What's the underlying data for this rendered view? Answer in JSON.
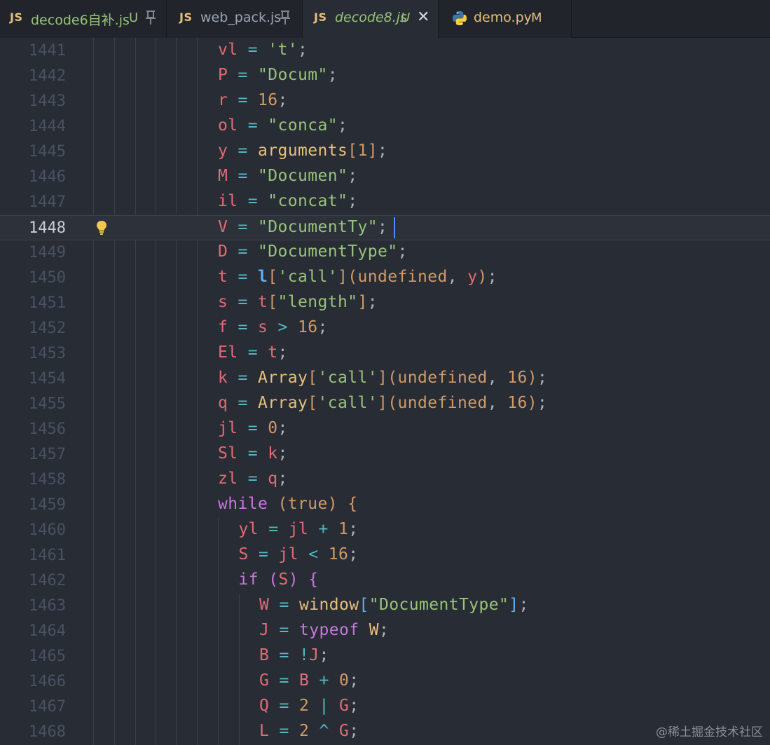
{
  "tabs": [
    {
      "badge": "JS",
      "label": "decode6自补.js",
      "status": "U",
      "pinned": true,
      "active": false,
      "label_color": "#98c379",
      "status_color": "#98c379"
    },
    {
      "badge": "JS",
      "label": "web_pack.js",
      "status": "",
      "pinned": true,
      "active": false,
      "label_color": "#9da5b4",
      "status_color": ""
    },
    {
      "badge": "JS",
      "label": "decode8.js",
      "status": "U",
      "pinned": false,
      "active": true,
      "close_icon": "✕",
      "label_color": "#98c379",
      "status_color": "#98c379"
    },
    {
      "badge": "",
      "icon": "python-icon",
      "label": "demo.py",
      "status": "M",
      "pinned": false,
      "active": false,
      "label_color": "#e5c07b",
      "status_color": "#e5c07b"
    }
  ],
  "editor": {
    "current_line": "1448",
    "lines": [
      {
        "num": "1441",
        "indent": 0,
        "tokens": [
          [
            "var",
            "vl"
          ],
          [
            "pun",
            " "
          ],
          [
            "op",
            "="
          ],
          [
            "pun",
            " "
          ],
          [
            "str",
            "'t'"
          ],
          [
            "pun",
            ";"
          ]
        ]
      },
      {
        "num": "1442",
        "indent": 0,
        "tokens": [
          [
            "var",
            "P"
          ],
          [
            "pun",
            " "
          ],
          [
            "op",
            "="
          ],
          [
            "pun",
            " "
          ],
          [
            "str",
            "\"Docum\""
          ],
          [
            "pun",
            ";"
          ]
        ]
      },
      {
        "num": "1443",
        "indent": 0,
        "tokens": [
          [
            "var",
            "r"
          ],
          [
            "pun",
            " "
          ],
          [
            "op",
            "="
          ],
          [
            "pun",
            " "
          ],
          [
            "num",
            "16"
          ],
          [
            "pun",
            ";"
          ]
        ]
      },
      {
        "num": "1444",
        "indent": 0,
        "tokens": [
          [
            "var",
            "ol"
          ],
          [
            "pun",
            " "
          ],
          [
            "op",
            "="
          ],
          [
            "pun",
            " "
          ],
          [
            "str",
            "\"conca\""
          ],
          [
            "pun",
            ";"
          ]
        ]
      },
      {
        "num": "1445",
        "indent": 0,
        "tokens": [
          [
            "var",
            "y"
          ],
          [
            "pun",
            " "
          ],
          [
            "op",
            "="
          ],
          [
            "pun",
            " "
          ],
          [
            "fn",
            "arguments"
          ],
          [
            "br1",
            "["
          ],
          [
            "num",
            "1"
          ],
          [
            "br1",
            "]"
          ],
          [
            "pun",
            ";"
          ]
        ]
      },
      {
        "num": "1446",
        "indent": 0,
        "tokens": [
          [
            "var",
            "M"
          ],
          [
            "pun",
            " "
          ],
          [
            "op",
            "="
          ],
          [
            "pun",
            " "
          ],
          [
            "str",
            "\"Documen\""
          ],
          [
            "pun",
            ";"
          ]
        ]
      },
      {
        "num": "1447",
        "indent": 0,
        "tokens": [
          [
            "var",
            "il"
          ],
          [
            "pun",
            " "
          ],
          [
            "op",
            "="
          ],
          [
            "pun",
            " "
          ],
          [
            "str",
            "\"concat\""
          ],
          [
            "pun",
            ";"
          ]
        ]
      },
      {
        "num": "1448",
        "indent": 0,
        "tokens": [
          [
            "var",
            "V"
          ],
          [
            "pun",
            " "
          ],
          [
            "op",
            "="
          ],
          [
            "pun",
            " "
          ],
          [
            "str",
            "\"DocumentTy\""
          ],
          [
            "pun",
            ";"
          ]
        ]
      },
      {
        "num": "1449",
        "indent": 0,
        "tokens": [
          [
            "var",
            "D"
          ],
          [
            "pun",
            " "
          ],
          [
            "op",
            "="
          ],
          [
            "pun",
            " "
          ],
          [
            "str",
            "\"DocumentType\""
          ],
          [
            "pun",
            ";"
          ]
        ]
      },
      {
        "num": "1450",
        "indent": 0,
        "tokens": [
          [
            "var",
            "t"
          ],
          [
            "pun",
            " "
          ],
          [
            "op",
            "="
          ],
          [
            "pun",
            " "
          ],
          [
            "call",
            "l"
          ],
          [
            "br1",
            "["
          ],
          [
            "str",
            "'call'"
          ],
          [
            "br1",
            "]"
          ],
          [
            "br1",
            "("
          ],
          [
            "num",
            "undefined"
          ],
          [
            "pun",
            ", "
          ],
          [
            "var",
            "y"
          ],
          [
            "br1",
            ")"
          ],
          [
            "pun",
            ";"
          ]
        ]
      },
      {
        "num": "1451",
        "indent": 0,
        "tokens": [
          [
            "var",
            "s"
          ],
          [
            "pun",
            " "
          ],
          [
            "op",
            "="
          ],
          [
            "pun",
            " "
          ],
          [
            "var",
            "t"
          ],
          [
            "br1",
            "["
          ],
          [
            "str",
            "\"length\""
          ],
          [
            "br1",
            "]"
          ],
          [
            "pun",
            ";"
          ]
        ]
      },
      {
        "num": "1452",
        "indent": 0,
        "tokens": [
          [
            "var",
            "f"
          ],
          [
            "pun",
            " "
          ],
          [
            "op",
            "="
          ],
          [
            "pun",
            " "
          ],
          [
            "var",
            "s"
          ],
          [
            "pun",
            " "
          ],
          [
            "op",
            ">"
          ],
          [
            "pun",
            " "
          ],
          [
            "num",
            "16"
          ],
          [
            "pun",
            ";"
          ]
        ]
      },
      {
        "num": "1453",
        "indent": 0,
        "tokens": [
          [
            "var",
            "El"
          ],
          [
            "pun",
            " "
          ],
          [
            "op",
            "="
          ],
          [
            "pun",
            " "
          ],
          [
            "var",
            "t"
          ],
          [
            "pun",
            ";"
          ]
        ]
      },
      {
        "num": "1454",
        "indent": 0,
        "tokens": [
          [
            "var",
            "k"
          ],
          [
            "pun",
            " "
          ],
          [
            "op",
            "="
          ],
          [
            "pun",
            " "
          ],
          [
            "fn",
            "Array"
          ],
          [
            "br1",
            "["
          ],
          [
            "str",
            "'call'"
          ],
          [
            "br1",
            "]"
          ],
          [
            "br1",
            "("
          ],
          [
            "num",
            "undefined"
          ],
          [
            "pun",
            ", "
          ],
          [
            "num",
            "16"
          ],
          [
            "br1",
            ")"
          ],
          [
            "pun",
            ";"
          ]
        ]
      },
      {
        "num": "1455",
        "indent": 0,
        "tokens": [
          [
            "var",
            "q"
          ],
          [
            "pun",
            " "
          ],
          [
            "op",
            "="
          ],
          [
            "pun",
            " "
          ],
          [
            "fn",
            "Array"
          ],
          [
            "br1",
            "["
          ],
          [
            "str",
            "'call'"
          ],
          [
            "br1",
            "]"
          ],
          [
            "br1",
            "("
          ],
          [
            "num",
            "undefined"
          ],
          [
            "pun",
            ", "
          ],
          [
            "num",
            "16"
          ],
          [
            "br1",
            ")"
          ],
          [
            "pun",
            ";"
          ]
        ]
      },
      {
        "num": "1456",
        "indent": 0,
        "tokens": [
          [
            "var",
            "jl"
          ],
          [
            "pun",
            " "
          ],
          [
            "op",
            "="
          ],
          [
            "pun",
            " "
          ],
          [
            "num",
            "0"
          ],
          [
            "pun",
            ";"
          ]
        ]
      },
      {
        "num": "1457",
        "indent": 0,
        "tokens": [
          [
            "var",
            "Sl"
          ],
          [
            "pun",
            " "
          ],
          [
            "op",
            "="
          ],
          [
            "pun",
            " "
          ],
          [
            "var",
            "k"
          ],
          [
            "pun",
            ";"
          ]
        ]
      },
      {
        "num": "1458",
        "indent": 0,
        "tokens": [
          [
            "var",
            "zl"
          ],
          [
            "pun",
            " "
          ],
          [
            "op",
            "="
          ],
          [
            "pun",
            " "
          ],
          [
            "var",
            "q"
          ],
          [
            "pun",
            ";"
          ]
        ]
      },
      {
        "num": "1459",
        "indent": 0,
        "tokens": [
          [
            "kw",
            "while"
          ],
          [
            "pun",
            " "
          ],
          [
            "br1",
            "("
          ],
          [
            "num",
            "true"
          ],
          [
            "br1",
            ")"
          ],
          [
            "pun",
            " "
          ],
          [
            "br1",
            "{"
          ]
        ]
      },
      {
        "num": "1460",
        "indent": 1,
        "tokens": [
          [
            "var",
            "yl"
          ],
          [
            "pun",
            " "
          ],
          [
            "op",
            "="
          ],
          [
            "pun",
            " "
          ],
          [
            "var",
            "jl"
          ],
          [
            "pun",
            " "
          ],
          [
            "op",
            "+"
          ],
          [
            "pun",
            " "
          ],
          [
            "num",
            "1"
          ],
          [
            "pun",
            ";"
          ]
        ]
      },
      {
        "num": "1461",
        "indent": 1,
        "tokens": [
          [
            "var",
            "S"
          ],
          [
            "pun",
            " "
          ],
          [
            "op",
            "="
          ],
          [
            "pun",
            " "
          ],
          [
            "var",
            "jl"
          ],
          [
            "pun",
            " "
          ],
          [
            "op",
            "<"
          ],
          [
            "pun",
            " "
          ],
          [
            "num",
            "16"
          ],
          [
            "pun",
            ";"
          ]
        ]
      },
      {
        "num": "1462",
        "indent": 1,
        "tokens": [
          [
            "kw",
            "if"
          ],
          [
            "pun",
            " "
          ],
          [
            "br2",
            "("
          ],
          [
            "var",
            "S"
          ],
          [
            "br2",
            ")"
          ],
          [
            "pun",
            " "
          ],
          [
            "br2",
            "{"
          ]
        ]
      },
      {
        "num": "1463",
        "indent": 2,
        "tokens": [
          [
            "var",
            "W"
          ],
          [
            "pun",
            " "
          ],
          [
            "op",
            "="
          ],
          [
            "pun",
            " "
          ],
          [
            "fn",
            "window"
          ],
          [
            "br3",
            "["
          ],
          [
            "str",
            "\"DocumentType\""
          ],
          [
            "br3",
            "]"
          ],
          [
            "pun",
            ";"
          ]
        ]
      },
      {
        "num": "1464",
        "indent": 2,
        "tokens": [
          [
            "var",
            "J"
          ],
          [
            "pun",
            " "
          ],
          [
            "op",
            "="
          ],
          [
            "pun",
            " "
          ],
          [
            "kw",
            "typeof"
          ],
          [
            "pun",
            " "
          ],
          [
            "fn",
            "W"
          ],
          [
            "pun",
            ";"
          ]
        ]
      },
      {
        "num": "1465",
        "indent": 2,
        "tokens": [
          [
            "var",
            "B"
          ],
          [
            "pun",
            " "
          ],
          [
            "op",
            "="
          ],
          [
            "pun",
            " "
          ],
          [
            "op",
            "!"
          ],
          [
            "var",
            "J"
          ],
          [
            "pun",
            ";"
          ]
        ]
      },
      {
        "num": "1466",
        "indent": 2,
        "tokens": [
          [
            "var",
            "G"
          ],
          [
            "pun",
            " "
          ],
          [
            "op",
            "="
          ],
          [
            "pun",
            " "
          ],
          [
            "var",
            "B"
          ],
          [
            "pun",
            " "
          ],
          [
            "op",
            "+"
          ],
          [
            "pun",
            " "
          ],
          [
            "num",
            "0"
          ],
          [
            "pun",
            ";"
          ]
        ]
      },
      {
        "num": "1467",
        "indent": 2,
        "tokens": [
          [
            "var",
            "Q"
          ],
          [
            "pun",
            " "
          ],
          [
            "op",
            "="
          ],
          [
            "pun",
            " "
          ],
          [
            "num",
            "2"
          ],
          [
            "pun",
            " "
          ],
          [
            "op",
            "|"
          ],
          [
            "pun",
            " "
          ],
          [
            "var",
            "G"
          ],
          [
            "pun",
            ";"
          ]
        ]
      },
      {
        "num": "1468",
        "indent": 2,
        "tokens": [
          [
            "var",
            "L"
          ],
          [
            "pun",
            " "
          ],
          [
            "op",
            "="
          ],
          [
            "pun",
            " "
          ],
          [
            "num",
            "2"
          ],
          [
            "pun",
            " "
          ],
          [
            "op",
            "^"
          ],
          [
            "pun",
            " "
          ],
          [
            "var",
            "G"
          ],
          [
            "pun",
            ";"
          ]
        ]
      }
    ]
  },
  "watermark": "@稀土掘金技术社区"
}
